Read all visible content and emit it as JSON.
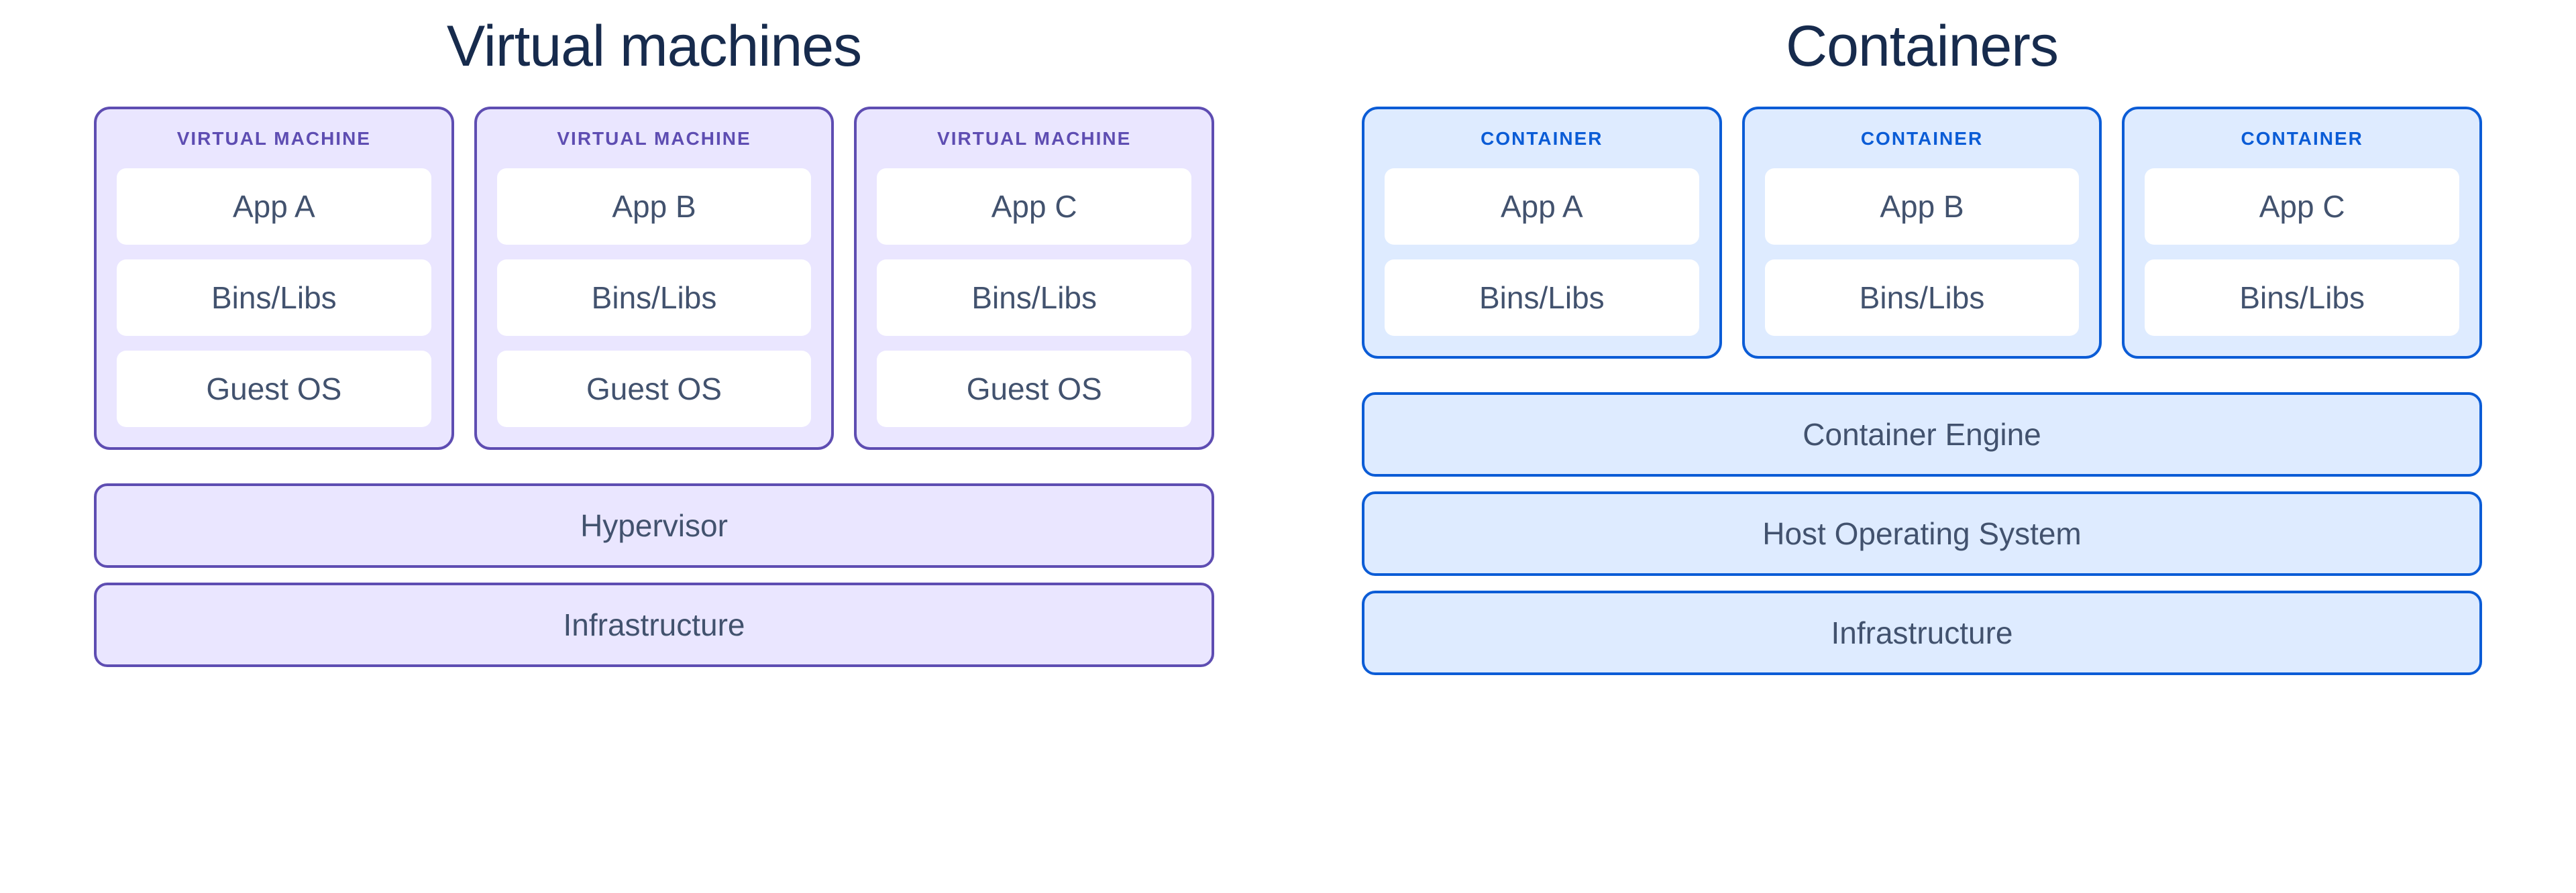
{
  "vm": {
    "title": "Virtual machines",
    "unit_label": "VIRTUAL MACHINE",
    "units": [
      {
        "app": "App A",
        "bins": "Bins/Libs",
        "guest": "Guest OS"
      },
      {
        "app": "App B",
        "bins": "Bins/Libs",
        "guest": "Guest OS"
      },
      {
        "app": "App C",
        "bins": "Bins/Libs",
        "guest": "Guest OS"
      }
    ],
    "shared_layers": [
      "Hypervisor",
      "Infrastructure"
    ]
  },
  "containers": {
    "title": "Containers",
    "unit_label": "CONTAINER",
    "units": [
      {
        "app": "App A",
        "bins": "Bins/Libs"
      },
      {
        "app": "App B",
        "bins": "Bins/Libs"
      },
      {
        "app": "App C",
        "bins": "Bins/Libs"
      }
    ],
    "shared_layers": [
      "Container Engine",
      "Host Operating System",
      "Infrastructure"
    ]
  },
  "colors": {
    "vm_border": "#5E4DB2",
    "vm_bg": "#EAE6FF",
    "ct_border": "#0B5CD6",
    "ct_bg": "#DEEBFF",
    "text": "#42526E"
  }
}
